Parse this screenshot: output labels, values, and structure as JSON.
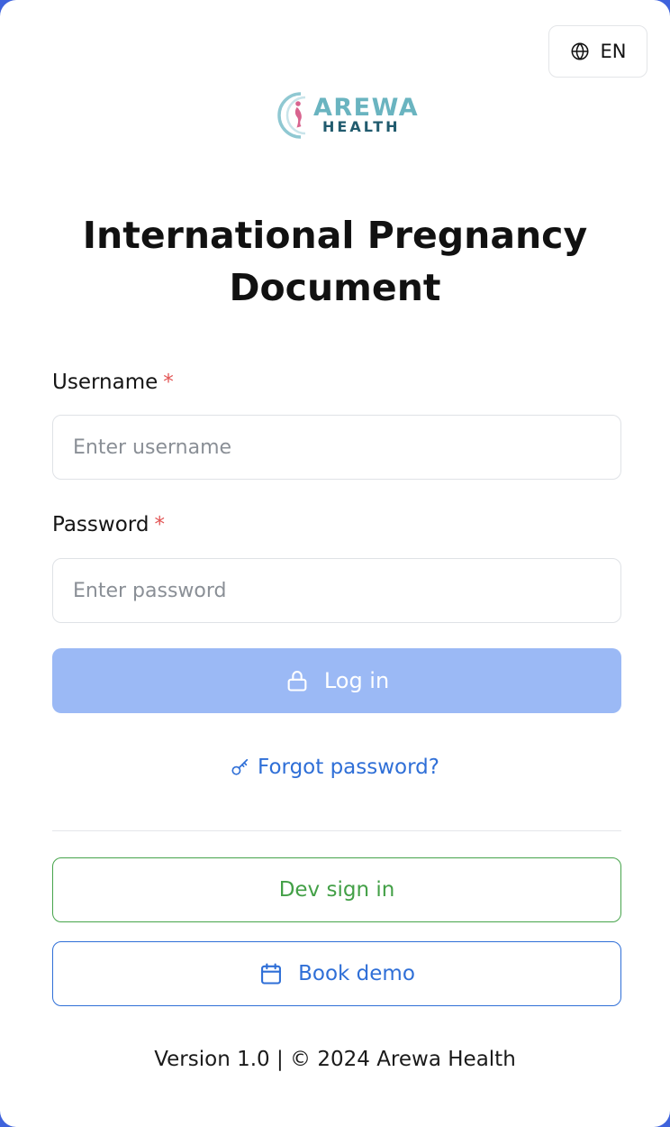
{
  "header": {
    "language_code": "EN",
    "language_icon": "globe-icon"
  },
  "logo": {
    "word1": "AREWA",
    "word2": "HEALTH"
  },
  "title": {
    "line1": "International Pregnancy",
    "line2": "Document"
  },
  "form": {
    "username_label": "Username",
    "username_required": "*",
    "username_placeholder": "Enter username",
    "username_value": "",
    "password_label": "Password",
    "password_required": "*",
    "password_placeholder": "Enter password",
    "password_value": "",
    "login_label": "Log in",
    "login_icon": "lock-icon",
    "forgot_label": "Forgot password?",
    "forgot_icon": "key-icon"
  },
  "actions": {
    "dev_signin_label": "Dev sign in",
    "book_demo_label": "Book demo",
    "book_demo_icon": "calendar-icon"
  },
  "footer": {
    "text": "Version 1.0 | © 2024 Arewa Health"
  },
  "colors": {
    "primary": "#2f6fd7",
    "primary_disabled": "#9bb9f5",
    "success": "#43a047",
    "required": "#e25555",
    "background_frame": "#3f63dc"
  }
}
